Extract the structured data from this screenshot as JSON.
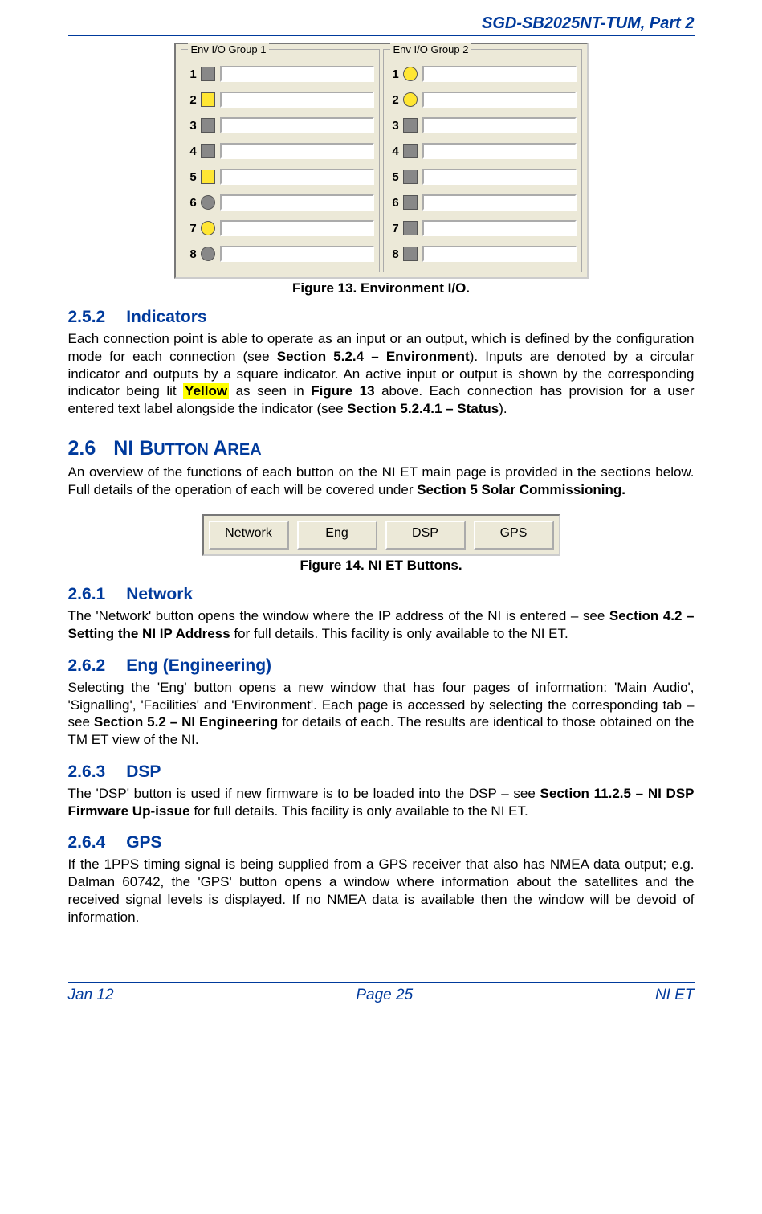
{
  "doc_header": "SGD-SB2025NT-TUM, Part 2",
  "env": {
    "group1": {
      "title": "Env I/O Group 1",
      "rows": [
        {
          "n": "1",
          "shape": "sq",
          "lit": false
        },
        {
          "n": "2",
          "shape": "sq",
          "lit": true
        },
        {
          "n": "3",
          "shape": "sq",
          "lit": false
        },
        {
          "n": "4",
          "shape": "sq",
          "lit": false
        },
        {
          "n": "5",
          "shape": "sq",
          "lit": true
        },
        {
          "n": "6",
          "shape": "rd",
          "lit": false
        },
        {
          "n": "7",
          "shape": "rd",
          "lit": true
        },
        {
          "n": "8",
          "shape": "rd",
          "lit": false
        }
      ]
    },
    "group2": {
      "title": "Env I/O Group 2",
      "rows": [
        {
          "n": "1",
          "shape": "rd",
          "lit": true
        },
        {
          "n": "2",
          "shape": "rd",
          "lit": true
        },
        {
          "n": "3",
          "shape": "sq",
          "lit": false
        },
        {
          "n": "4",
          "shape": "sq",
          "lit": false
        },
        {
          "n": "5",
          "shape": "sq",
          "lit": false
        },
        {
          "n": "6",
          "shape": "sq",
          "lit": false
        },
        {
          "n": "7",
          "shape": "sq",
          "lit": false
        },
        {
          "n": "8",
          "shape": "sq",
          "lit": false
        }
      ]
    }
  },
  "fig13_caption": "Figure 13.  Environment I/O.",
  "s252": {
    "num": "2.5.2",
    "title": "Indicators"
  },
  "s252_text_a": "Each connection point is able to operate as an input or an output, which is defined by the configuration mode for each connection (see ",
  "s252_text_b": "Section 5.2.4 – Environment",
  "s252_text_c": ").  Inputs are denoted by a circular indicator and outputs by a square indicator.  An active input or output is shown by the corresponding indicator being lit ",
  "s252_text_d": "Yellow",
  "s252_text_e": " as seen in ",
  "s252_text_f": "Figure 13",
  "s252_text_g": " above.  Each connection has provision for a user entered text label alongside the indicator (see ",
  "s252_text_h": "Section 5.2.4.1 – Status",
  "s252_text_i": ").",
  "s26": {
    "num": "2.6",
    "title_a": "NI B",
    "title_b": "UTTON ",
    "title_c": "A",
    "title_d": "REA"
  },
  "s26_text_a": "An overview of the functions of each button on the NI ET main page is provided in the sections below.  Full details of the operation of each will be covered under ",
  "s26_text_b": "Section 5 Solar Commissioning.",
  "buttons": {
    "network": "Network",
    "eng": "Eng",
    "dsp": "DSP",
    "gps": "GPS"
  },
  "fig14_caption": "Figure 14.  NI ET Buttons.",
  "s261": {
    "num": "2.6.1",
    "title": "Network"
  },
  "s261_text_a": "The 'Network' button opens the window where the IP address of the NI is entered – see ",
  "s261_text_b": "Section 4.2 – Setting the NI IP Address",
  "s261_text_c": " for full details.  This facility is only available to the NI ET.",
  "s262": {
    "num": "2.6.2",
    "title": "Eng (Engineering)"
  },
  "s262_text_a": "Selecting the 'Eng' button opens a new window that has four pages of information: 'Main Audio', 'Signalling', 'Facilities' and 'Environment'.  Each page is accessed by selecting the corresponding tab – see ",
  "s262_text_b": "Section 5.2 – NI Engineering",
  "s262_text_c": " for details of each.  The results are identical to those obtained on the TM ET view of the NI.",
  "s263": {
    "num": "2.6.3",
    "title": "DSP"
  },
  "s263_text_a": "The 'DSP' button is used if new firmware is to be loaded into the DSP – see ",
  "s263_text_b": "Section 11.2.5 – NI DSP Firmware Up-issue",
  "s263_text_c": " for full details.  This facility is only available to the NI ET.",
  "s264": {
    "num": "2.6.4",
    "title": "GPS"
  },
  "s264_text": "If the 1PPS timing signal is being supplied from a GPS receiver that also has NMEA data output; e.g. Dalman 60742, the 'GPS' button opens a window where information about the satellites and the received signal levels is displayed.  If no NMEA data is available then the window will be devoid of information.",
  "footer": {
    "left": "Jan 12",
    "center": "Page 25",
    "right": "NI ET"
  }
}
